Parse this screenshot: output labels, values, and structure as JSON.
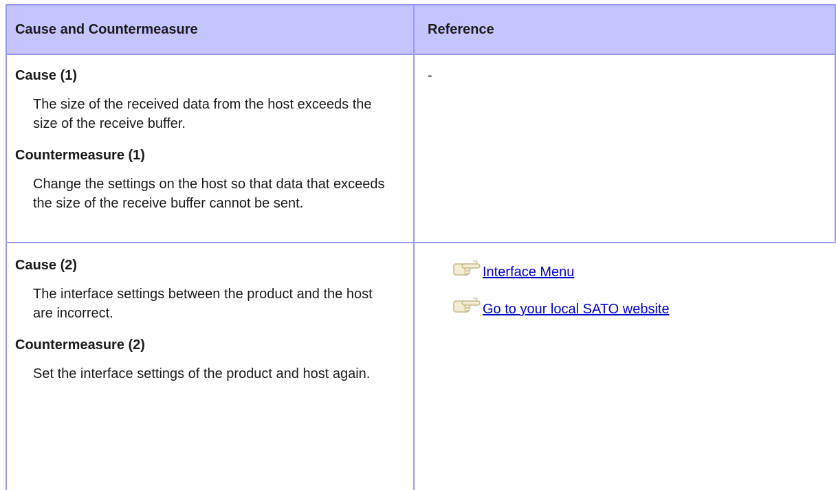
{
  "header": {
    "col1": "Cause and Countermeasure",
    "col2": "Reference"
  },
  "rows": [
    {
      "cause_title": "Cause (1)",
      "cause_text": "The size of the received data from the host exceeds the size of the receive buffer.",
      "counter_title": "Countermeasure (1)",
      "counter_text": "Change the settings on the host so that data that exceeds the size of the receive buffer cannot be sent.",
      "reference": "-"
    },
    {
      "cause_title": "Cause (2)",
      "cause_text": "The interface settings between the product and the host are incorrect.",
      "counter_title": "Countermeasure (2)",
      "counter_text": "Set the interface settings of the product and host again.",
      "links": [
        "Interface Menu",
        "Go to your local SATO website"
      ]
    }
  ],
  "icons": {
    "reference_link": "pointing-hand-icon"
  },
  "colors": {
    "header_bg": "#c4c4ff",
    "border": "#9a9af0",
    "link": "#0000cc"
  }
}
